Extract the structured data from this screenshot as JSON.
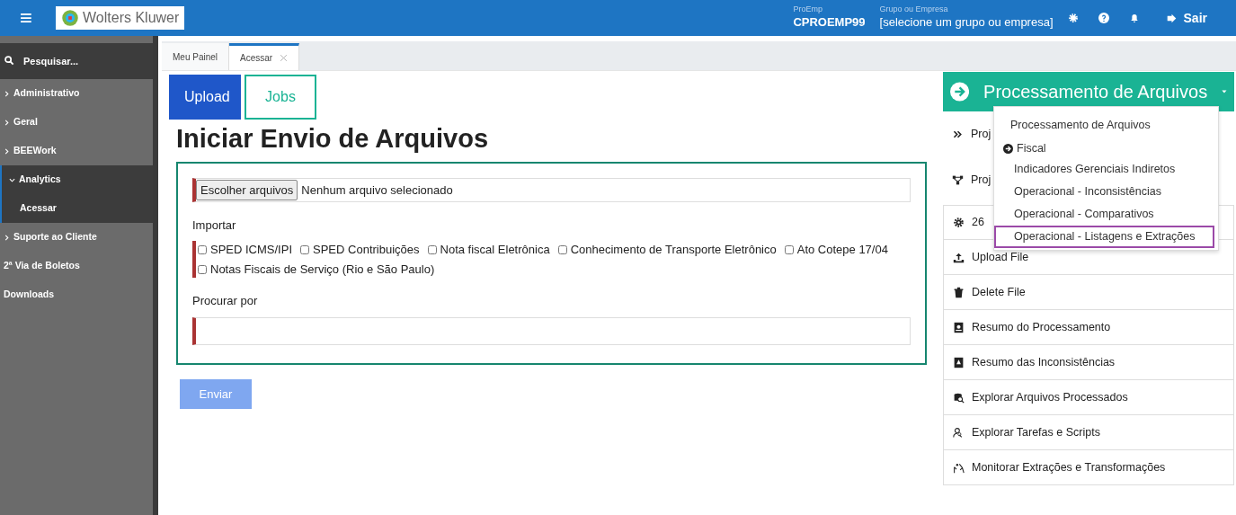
{
  "header": {
    "menu_glyph": "≡",
    "logo_text": "Wolters Kluwer",
    "proemp_label": "ProEmp",
    "proemp_value": "CPROEMP99",
    "group_label": "Grupo ou Empresa",
    "group_value": "[selecione um grupo ou empresa]",
    "logout": "Sair"
  },
  "sidebar": {
    "search_placeholder": "Pesquisar...",
    "items": [
      {
        "label": "Administrativo",
        "kind": "group",
        "expanded": false
      },
      {
        "label": "Geral",
        "kind": "group",
        "expanded": false
      },
      {
        "label": "BEEWork",
        "kind": "group",
        "expanded": false
      },
      {
        "label": "Analytics",
        "kind": "group",
        "expanded": true,
        "children": [
          {
            "label": "Acessar"
          }
        ]
      },
      {
        "label": "Suporte ao Cliente",
        "kind": "group",
        "expanded": false
      },
      {
        "label": "2ª Via de Boletos",
        "kind": "link"
      },
      {
        "label": "Downloads",
        "kind": "link"
      }
    ]
  },
  "tabs": [
    {
      "label": "Meu Painel",
      "selected": false
    },
    {
      "label": "Acessar",
      "selected": true
    }
  ],
  "subtabs": [
    {
      "label": "Upload",
      "selected": true
    },
    {
      "label": "Jobs",
      "selected": false
    }
  ],
  "form": {
    "title": "Iniciar Envio de Arquivos",
    "file_button": "Escolher arquivos",
    "file_status": "Nenhum arquivo selecionado",
    "import_label": "Importar",
    "options": [
      {
        "label": "SPED ICMS/IPI",
        "checked": false
      },
      {
        "label": "SPED Contribuições",
        "checked": false
      },
      {
        "label": "Nota fiscal Eletrônica",
        "checked": false
      },
      {
        "label": "Conhecimento de Transporte Eletrônico",
        "checked": false
      },
      {
        "label": "Ato Cotepe 17/04",
        "checked": false
      },
      {
        "label": "Notas Fiscais de Serviço (Rio e São Paulo)",
        "checked": false
      }
    ],
    "search_label": "Procurar por",
    "submit": "Enviar",
    "submit_disabled": true
  },
  "panel": {
    "title": "Processamento de Arquivos",
    "actions": [
      {
        "label": "Proj",
        "kind": "inline"
      },
      {
        "label": "Proj",
        "kind": "inline"
      },
      {
        "label": "26",
        "kind": "row"
      },
      {
        "label": "Upload File",
        "kind": "row"
      },
      {
        "label": "Delete File",
        "kind": "row"
      },
      {
        "label": "Resumo do Processamento",
        "kind": "row"
      },
      {
        "label": "Resumo das Inconsistências",
        "kind": "row"
      },
      {
        "label": "Explorar Arquivos Processados",
        "kind": "row"
      },
      {
        "label": "Explorar Tarefas e Scripts",
        "kind": "row"
      },
      {
        "label": "Monitorar Extrações e Transformações",
        "kind": "row"
      }
    ],
    "menu": [
      {
        "label": "Processamento de Arquivos",
        "kind": "header"
      },
      {
        "label": "Fiscal",
        "kind": "section"
      },
      {
        "label": "Indicadores Gerenciais Indiretos",
        "kind": "item",
        "selected": false
      },
      {
        "label": "Operacional - Inconsistências",
        "kind": "item",
        "selected": false
      },
      {
        "label": "Operacional - Comparativos",
        "kind": "item",
        "selected": false
      },
      {
        "label": "Operacional - Listagens e Extrações",
        "kind": "item",
        "selected": true
      }
    ]
  }
}
